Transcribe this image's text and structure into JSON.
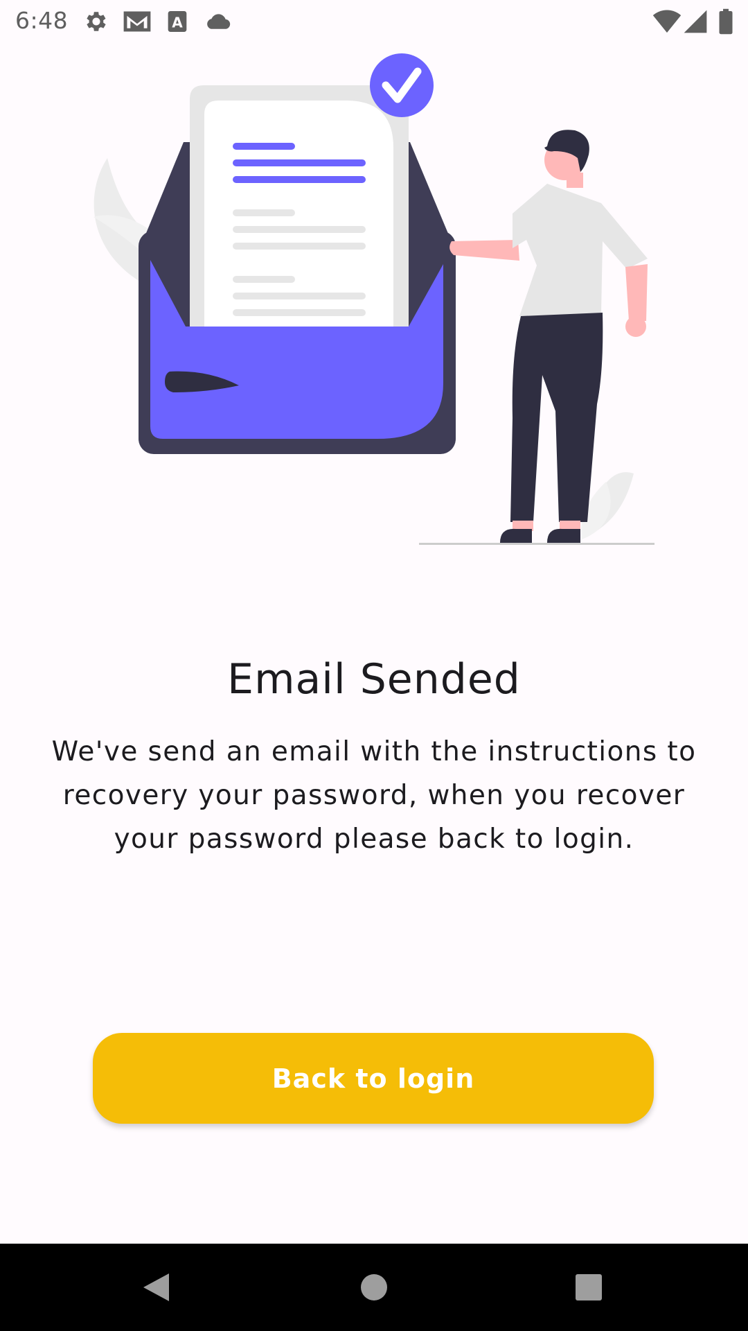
{
  "status_bar": {
    "time": "6:48",
    "icons": [
      "settings-gear-icon",
      "gmail-icon",
      "keyboard-a-icon",
      "cloud-icon",
      "wifi-icon",
      "signal-icon",
      "battery-icon"
    ]
  },
  "illustration": {
    "description_icons": [
      "envelope-icon",
      "document-icon",
      "checkmark-badge-icon",
      "person-figure"
    ],
    "colors": {
      "accent": "#6c63ff",
      "envelope_dark": "#3f3d56",
      "pants": "#2f2e41",
      "skin": "#ffb8b8",
      "shirt": "#e6e6e6"
    }
  },
  "content": {
    "title": "Email Sended",
    "message": "We've send an email with the instructions to recovery your password, when you recover your password please back to login."
  },
  "actions": {
    "back_to_login_label": "Back to login",
    "button_color": "#f5bd07"
  },
  "nav_bar": {
    "buttons": [
      "back-triangle-icon",
      "home-circle-icon",
      "recents-square-icon"
    ]
  }
}
